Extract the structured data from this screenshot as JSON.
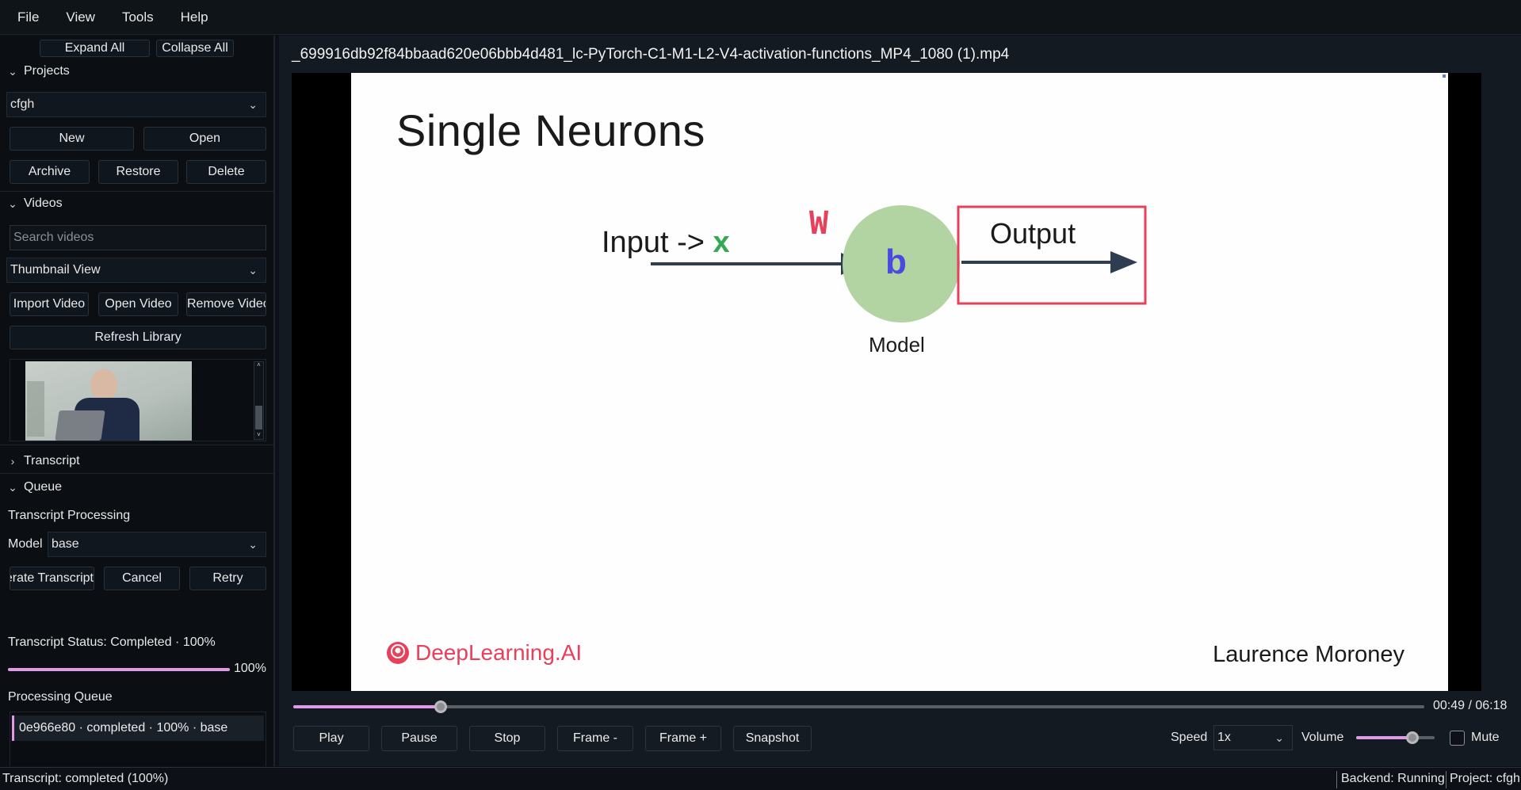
{
  "menu": [
    "File",
    "View",
    "Tools",
    "Help"
  ],
  "sidebar": {
    "expand_all": "Expand All",
    "collapse_all": "Collapse All",
    "projects": {
      "header": "Projects",
      "selected": "cfgh",
      "new": "New",
      "open": "Open",
      "archive": "Archive",
      "restore": "Restore",
      "delete": "Delete"
    },
    "videos": {
      "header": "Videos",
      "search_placeholder": "Search videos",
      "view_mode": "Thumbnail View",
      "import": "Import Video",
      "open": "Open Video",
      "remove": "Remove Video",
      "refresh": "Refresh Library"
    },
    "transcript": {
      "header": "Transcript"
    },
    "queue": {
      "header": "Queue",
      "processing_label": "Transcript Processing",
      "model_label": "Model",
      "model_value": "base",
      "generate": "Generate Transcript",
      "cancel": "Cancel",
      "retry": "Retry",
      "status": "Transcript Status: Completed · 100%",
      "progress_value": 1.0,
      "progress_text": "100%",
      "queue_label": "Processing Queue",
      "items": [
        "0e966e80 · completed · 100% · base"
      ]
    }
  },
  "player": {
    "file_name": "_699916db92f84bbaad620e06bbb4d481_lc-PyTorch-C1-M1-L2-V4-activation-functions_MP4_1080 (1).mp4",
    "slide": {
      "title": "Single Neurons",
      "input_label": "Input ->",
      "input_var": "x",
      "weight": "W",
      "bias": "b",
      "output_label": "Output",
      "model_label": "Model",
      "brand": "DeepLearning.AI",
      "presenter": "Laurence Moroney"
    },
    "position": "00:49",
    "duration": "06:18",
    "time_readout": "00:49 / 06:18",
    "progress_fraction": 0.13,
    "controls": [
      "Play",
      "Pause",
      "Stop",
      "Frame -",
      "Frame +",
      "Snapshot"
    ],
    "speed_label": "Speed",
    "speed_value": "1x",
    "volume_label": "Volume",
    "volume_fraction": 0.72,
    "mute_label": "Mute"
  },
  "statusbar": {
    "left": "Transcript: completed (100%)",
    "backend": "Backend: Running",
    "project": "Project: cfgh"
  },
  "colors": {
    "accent": "#e09ae8",
    "slide_red": "#e8405a",
    "slide_green": "#34a853",
    "slide_blue": "#4a4ae0",
    "node_green": "#b2d4a2"
  }
}
